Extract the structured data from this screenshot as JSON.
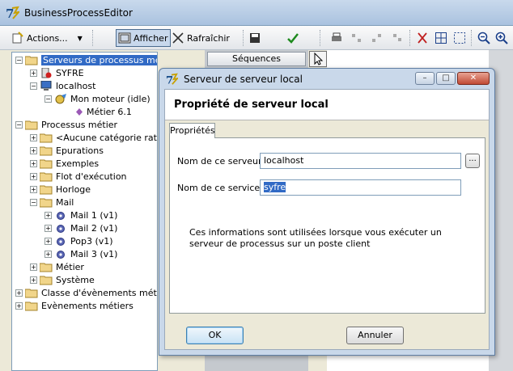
{
  "app": {
    "title": "BusinessProcessEditor"
  },
  "toolbar": {
    "actions_label": "Actions...",
    "afficher_label": "Afficher",
    "rafraichir_label": "Rafraîchir"
  },
  "tree": {
    "rows": [
      {
        "label": "Serveurs de processus métier"
      },
      {
        "label": "SYFRE"
      },
      {
        "label": "localhost"
      },
      {
        "label": "Mon moteur (idle)"
      },
      {
        "label": "Métier 6.1"
      },
      {
        "label": "Processus métier"
      },
      {
        "label": "<Aucune catégorie rattachée>"
      },
      {
        "label": "Epurations"
      },
      {
        "label": "Exemples"
      },
      {
        "label": "Flot d'exécution"
      },
      {
        "label": "Horloge"
      },
      {
        "label": "Mail"
      },
      {
        "label": "Mail 1 (v1)"
      },
      {
        "label": "Mail 2 (v1)"
      },
      {
        "label": "Pop3 (v1)"
      },
      {
        "label": "Mail 3 (v1)"
      },
      {
        "label": "Métier"
      },
      {
        "label": "Système"
      },
      {
        "label": "Classe d'évènements métiers"
      },
      {
        "label": "Evènements métiers"
      }
    ]
  },
  "middle": {
    "button_label": "Séquences"
  },
  "dialog": {
    "title": "Serveur de serveur local",
    "header": "Propriété de serveur local",
    "tab_label": "Propriétés",
    "server_name_label": "Nom de ce serveur :",
    "server_name_value": "localhost",
    "service_name_label": "Nom de ce service :",
    "service_name_value": "syfre",
    "browse_label": "...",
    "info_text": "Ces informations sont utilisées lorsque vous exécuter un serveur de processus sur un poste client",
    "ok_label": "OK",
    "cancel_label": "Annuler",
    "minimize_label": "–",
    "maximize_label": "□",
    "close_label": "✕"
  },
  "colors": {
    "selection": "#316ac5",
    "title_bar": "#a9c2df"
  }
}
